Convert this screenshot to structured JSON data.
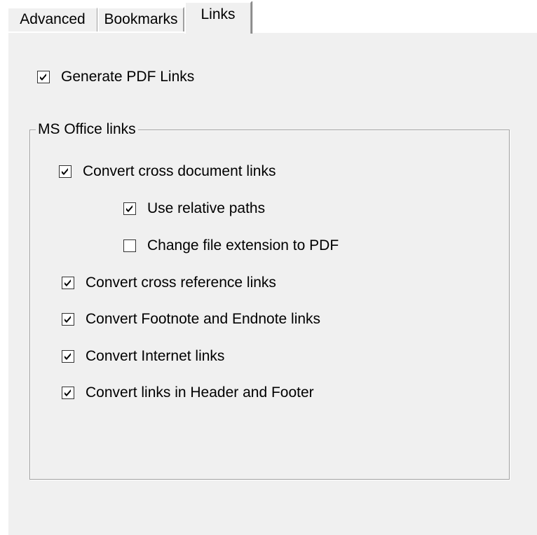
{
  "tabs": [
    {
      "label": "Advanced"
    },
    {
      "label": "Bookmarks"
    },
    {
      "label": "Links",
      "active": true
    }
  ],
  "generate_pdf_links": {
    "label": "Generate PDF Links",
    "checked": true
  },
  "ms_office_group": {
    "title": "MS Office links",
    "options": [
      {
        "label": "Convert cross document links",
        "checked": true
      },
      {
        "label": "Use relative paths",
        "checked": true
      },
      {
        "label": "Change file extension to PDF",
        "checked": false
      },
      {
        "label": "Convert cross reference links",
        "checked": true
      },
      {
        "label": "Convert Footnote and Endnote links",
        "checked": true
      },
      {
        "label": "Convert Internet links",
        "checked": true
      },
      {
        "label": "Convert links in Header and Footer",
        "checked": true
      }
    ]
  },
  "colors": {
    "face": "#f0f0f0",
    "highlight": "#ffffff",
    "shadow": "#a0a0a0",
    "check": "#000000"
  }
}
